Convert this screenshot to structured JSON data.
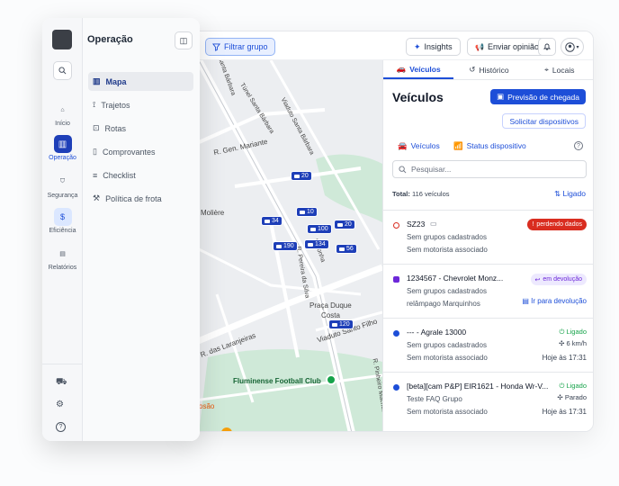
{
  "topbar": {
    "filter_label": "Filtrar grupo",
    "insights_label": "Insights",
    "feedback_label": "Enviar opinião"
  },
  "map": {
    "labels": [
      "R. Gen. Mariante",
      "Molière",
      "Praça Duque",
      "Costa",
      "R. das Laranjeiras",
      "Fluminense Football Club",
      "Viaduto Santa Bárbara",
      "Viaduto Santo Filho",
      "R. Pinheiro Machado",
      "Túnel Santa Bárbara",
      "R. Pereira da Silva",
      "R. Santa Bárbara",
      "Noronha",
      "osão"
    ],
    "markers": [
      "20",
      "10",
      "34",
      "100",
      "20",
      "190",
      "134",
      "56",
      "120"
    ]
  },
  "panel": {
    "tabs": [
      "Veículos",
      "Histórico",
      "Locais"
    ],
    "heading": "Veículos",
    "arrival_btn": "Previsão de chegada",
    "request_btn": "Solicitar dispositivos",
    "subtab_vehicles": "Veículos",
    "subtab_status": "Status dispositivo",
    "search_placeholder": "Pesquisar...",
    "total_label": "Total:",
    "total_value": "116 veículos",
    "filter_on": "Ligado",
    "rows": [
      {
        "title": "SZ23",
        "l2": "Sem grupos cadastrados",
        "l3": "Sem motorista associado",
        "badge": "perdendo dados"
      },
      {
        "title": "1234567 - Chevrolet Monz...",
        "l2": "Sem grupos cadastrados",
        "l3": "relâmpago Marquinhos",
        "badge": "em devolução",
        "link": "Ir para devolução"
      },
      {
        "title": "--- - Agrale 13000",
        "l2": "Sem grupos cadastrados",
        "l3": "Sem motorista associado",
        "status": "Ligado",
        "speed": "6 km/h",
        "time": "Hoje às 17:31"
      },
      {
        "title": "[beta][cam P&P] EIR1621 - Honda Wr-V...",
        "l2": "Teste FAQ Grupo",
        "l3": "Sem motorista associado",
        "status": "Ligado",
        "speed": "Parado",
        "time": "Hoje às 17:31"
      }
    ]
  },
  "sidebar": {
    "title": "Operação",
    "rail": [
      {
        "label": "Início"
      },
      {
        "label": "Operação"
      },
      {
        "label": "Segurança"
      },
      {
        "label": "Eficiência"
      },
      {
        "label": "Relatórios"
      }
    ],
    "menu": [
      "Mapa",
      "Trajetos",
      "Rotas",
      "Comprovantes",
      "Checklist",
      "Política de frota"
    ]
  },
  "colors": {
    "accent": "#1d4ed8",
    "alert": "#d92d20",
    "ok": "#16a34a"
  }
}
